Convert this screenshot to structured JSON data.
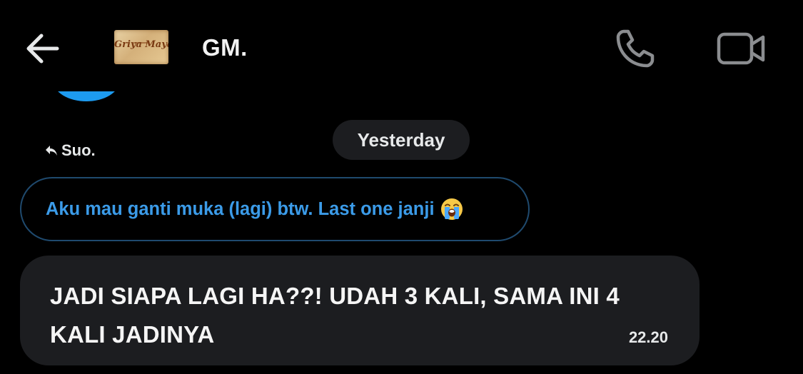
{
  "header": {
    "chat_name": "GM.",
    "avatar_text": "Griya Maya",
    "icons": {
      "back": "arrow-left-icon",
      "call": "phone-icon",
      "video": "video-camera-icon"
    }
  },
  "messages": {
    "date_separator": "Yesterday",
    "reply_to_label": "Suo.",
    "quoted_text": "Aku mau ganti muka (lagi) btw. Last one janji",
    "quoted_emoji": "loudly-crying-face-emoji",
    "message_text": "JADI SIAPA LAGI HA??! UDAH 3 KALI, SAMA INI 4 KALI JADINYA",
    "timestamp": "22.20"
  },
  "colors": {
    "background": "#000000",
    "bubble": "#1c1d20",
    "accent": "#1d9bf0",
    "quoted_text": "#3b9be8"
  }
}
